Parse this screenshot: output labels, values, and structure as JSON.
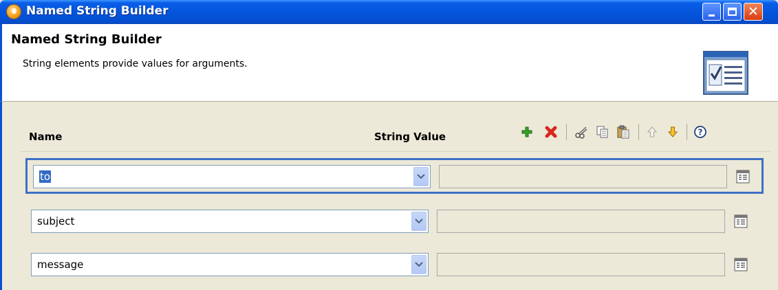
{
  "window": {
    "title": "Named String Builder"
  },
  "header": {
    "title": "Named String Builder",
    "description": "String elements provide values for arguments."
  },
  "columns": {
    "name": "Name",
    "value": "String Value"
  },
  "toolbar": {
    "buttons": [
      "add-icon",
      "delete-icon",
      "cut-icon",
      "copy-icon",
      "paste-icon",
      "move-up-icon",
      "move-down-icon",
      "help-icon"
    ]
  },
  "rows": [
    {
      "name": "to",
      "value": ""
    },
    {
      "name": "subject",
      "value": ""
    },
    {
      "name": "message",
      "value": ""
    }
  ],
  "colors": {
    "titlebar": "#0455dc",
    "selection_border": "#3e70c4",
    "panel": "#ece9d8"
  }
}
